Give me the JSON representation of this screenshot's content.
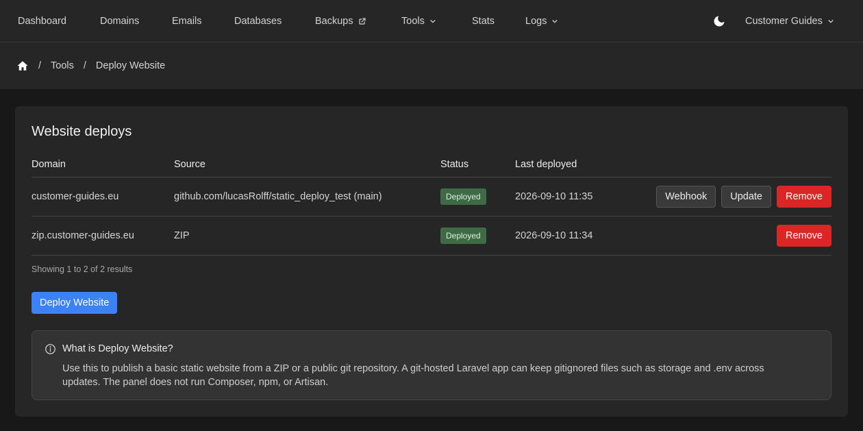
{
  "nav": {
    "items": [
      {
        "label": "Dashboard"
      },
      {
        "label": "Domains"
      },
      {
        "label": "Emails"
      },
      {
        "label": "Databases"
      },
      {
        "label": "Backups",
        "icon": "external-link-icon"
      },
      {
        "label": "Tools",
        "icon": "chevron-down-icon"
      },
      {
        "label": "Stats"
      },
      {
        "label": "Logs",
        "icon": "chevron-down-icon"
      }
    ],
    "theme_icon": "moon-icon",
    "account_label": "Customer Guides"
  },
  "breadcrumb": {
    "home_icon": "home-icon",
    "items": [
      "Tools",
      "Deploy Website"
    ],
    "separator": "/"
  },
  "card": {
    "title": "Website deploys",
    "columns": [
      "Domain",
      "Source",
      "Status",
      "Last deployed"
    ],
    "rows": [
      {
        "domain": "customer-guides.eu",
        "source": "github.com/lucasRolff/static_deploy_test (main)",
        "status": "Deployed",
        "last_deployed": "2026-09-10 11:35",
        "actions": [
          "Webhook",
          "Update",
          "Remove"
        ]
      },
      {
        "domain": "zip.customer-guides.eu",
        "source": "ZIP",
        "status": "Deployed",
        "last_deployed": "2026-09-10 11:34",
        "actions": [
          "Remove"
        ]
      }
    ],
    "showing": "Showing 1 to 2 of 2 results",
    "deploy_button": "Deploy Website"
  },
  "info": {
    "icon": "info-icon",
    "title": "What is Deploy Website?",
    "text": "Use this to publish a basic static website from a ZIP or a public git repository. A git-hosted Laravel app can keep gitignored files such as storage and .env across updates. The panel does not run Composer, npm, or Artisan."
  },
  "colors": {
    "accent": "#3b82f6",
    "danger": "#dc2626",
    "success_badge": "#3e6b45"
  }
}
